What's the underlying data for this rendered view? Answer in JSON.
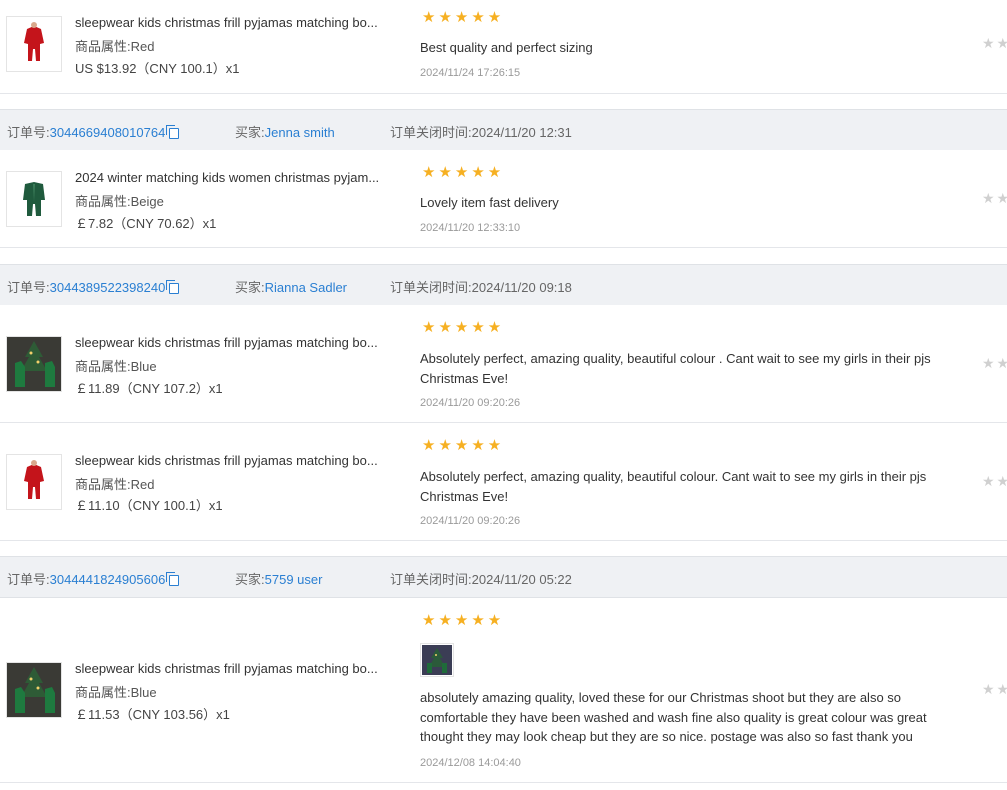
{
  "labels": {
    "order_no": "订单号:",
    "buyer": "买家:",
    "closed_time": "订单关闭时间:",
    "attr": "商品属性:"
  },
  "rating_stars": "★★★★★",
  "right_stars": "★★",
  "items": [
    {
      "title": "sleepwear kids christmas frill pyjamas matching bo...",
      "attr_value": "Red",
      "price": "US $13.92（CNY  100.1）x1",
      "review": "Best quality and perfect sizing",
      "date": "2024/11/24 17:26:15",
      "thumb": "red-pajamas"
    },
    {
      "title": "2024 winter matching kids women christmas pyjam...",
      "attr_value": "Beige",
      "price": "￡7.82（CNY  70.62）x1",
      "review": "Lovely item fast delivery",
      "date": "2024/11/20 12:33:10",
      "thumb": "green-pajamas"
    },
    {
      "title": "sleepwear kids christmas frill pyjamas matching bo...",
      "attr_value": "Blue",
      "price": "￡11.89（CNY  107.2）x1",
      "review": "Absolutely perfect, amazing quality, beautiful colour . Cant wait to see my girls in their pjs Christmas Eve!",
      "date": "2024/11/20 09:20:26",
      "thumb": "green-kids-tree"
    },
    {
      "title": "sleepwear kids christmas frill pyjamas matching bo...",
      "attr_value": "Red",
      "price": "￡11.10（CNY  100.1）x1",
      "review": "Absolutely perfect, amazing quality, beautiful colour. Cant wait to see my girls in their pjs Christmas Eve!",
      "date": "2024/11/20 09:20:26",
      "thumb": "red-pajamas"
    },
    {
      "title": "sleepwear kids christmas frill pyjamas matching bo...",
      "attr_value": "Blue",
      "price": "￡11.53（CNY  103.56）x1",
      "review": "absolutely amazing quality, loved these for our Christmas shoot but they are also so comfortable they have been washed and wash fine also quality is great colour was great thought they may look cheap but they are so nice. postage was also so fast thank you",
      "date": "2024/12/08 14:04:40",
      "thumb": "green-kids-tree",
      "has_photo": true
    }
  ],
  "orders": [
    {
      "order_no": "3044669408010764",
      "buyer": "Jenna smith",
      "closed_time": "2024/11/20 12:31"
    },
    {
      "order_no": "3044389522398240",
      "buyer": "Rianna Sadler",
      "closed_time": "2024/11/20 09:18"
    },
    {
      "order_no": "3044441824905606",
      "buyer": "5759 user",
      "closed_time": "2024/11/20 05:22"
    }
  ],
  "colors": {
    "link": "#2a7fd2",
    "star": "#f6b022",
    "header_bg": "#eff1f4"
  }
}
